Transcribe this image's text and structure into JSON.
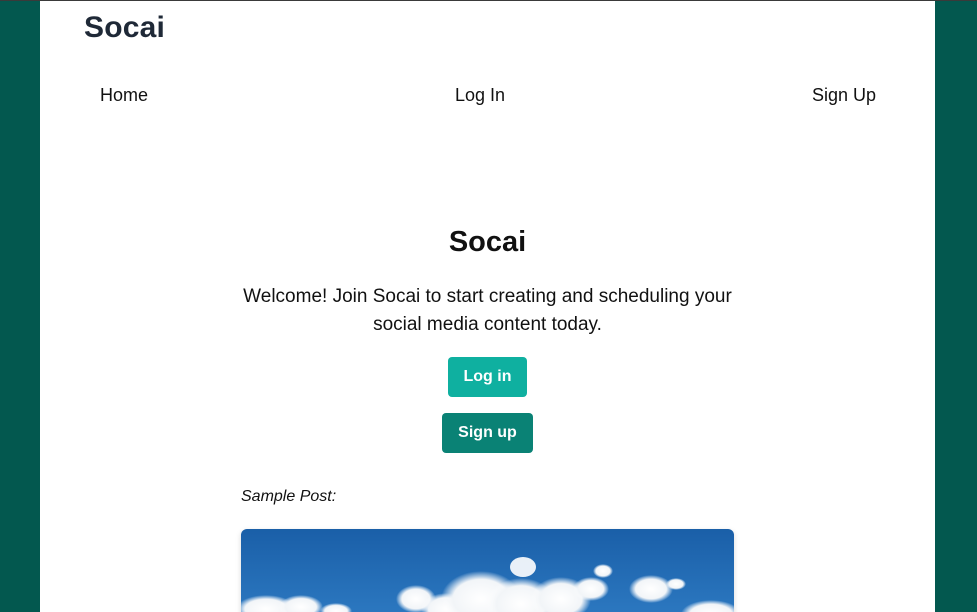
{
  "brand": {
    "name": "Socai"
  },
  "nav": {
    "home": "Home",
    "login": "Log In",
    "signup": "Sign Up"
  },
  "hero": {
    "title": "Socai",
    "text": "Welcome! Join Socai to start creating and scheduling your social media content today.",
    "login_button": "Log in",
    "signup_button": "Sign up"
  },
  "sample": {
    "label": "Sample Post:",
    "image": "sky-with-clouds-image"
  },
  "colors": {
    "frame": "#03584f",
    "login_button": "#0fb0a0",
    "signup_button": "#0a8275"
  }
}
